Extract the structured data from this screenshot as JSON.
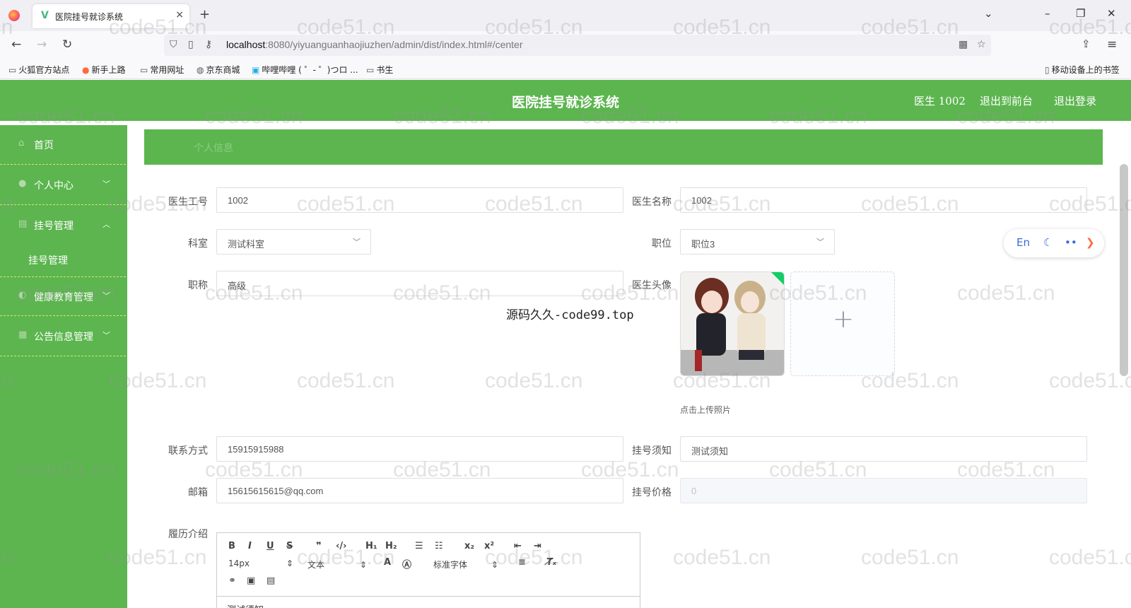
{
  "browser": {
    "tab_title": "医院挂号就诊系统",
    "tab_close": "×",
    "new_tab": "+",
    "url_host": "localhost",
    "url_path": ":8080/yiyuanguanhaojiuzhen/admin/dist/index.html#/center",
    "bookmarks": [
      "火狐官方站点",
      "新手上路",
      "常用网址",
      "京东商城",
      "哔哩哔哩 ( ゜- ゜)つロ ...",
      "书生"
    ],
    "mobile_bookmarks": "移动设备上的书签"
  },
  "header": {
    "title": "医院挂号就诊系统",
    "user": "医生 1002",
    "to_front": "退出到前台",
    "logout": "退出登录"
  },
  "sidebar": {
    "items": [
      {
        "label": "首页"
      },
      {
        "label": "个人中心"
      },
      {
        "label": "挂号管理"
      },
      {
        "label": "健康教育管理"
      },
      {
        "label": "公告信息管理"
      }
    ],
    "sub_item": "挂号管理"
  },
  "breadcrumb": "个人信息",
  "form": {
    "doctor_no_label": "医生工号",
    "doctor_no": "1002",
    "doctor_name_label": "医生名称",
    "doctor_name": "1002",
    "dept_label": "科室",
    "dept": "测试科室",
    "position_label": "职位",
    "position": "职位3",
    "title_label": "职称",
    "title": "高级",
    "avatar_label": "医生头像",
    "upload_plus": "+",
    "upload_tip": "点击上传照片",
    "phone_label": "联系方式",
    "phone": "15915915988",
    "notice_label": "挂号须知",
    "notice": "测试须知",
    "email_label": "邮箱",
    "email": "15615615615@qq.com",
    "price_label": "挂号价格",
    "price": "0",
    "resume_label": "履历介绍"
  },
  "editor": {
    "font_size": "14px",
    "text_type": "文本",
    "font_family": "标准字体",
    "content": "测试须知"
  },
  "lang_widget": {
    "label": "En"
  },
  "overlay_text": "源码久久-code99.top",
  "watermark": "code51.cn",
  "colors": {
    "primary": "#5cb54f"
  }
}
